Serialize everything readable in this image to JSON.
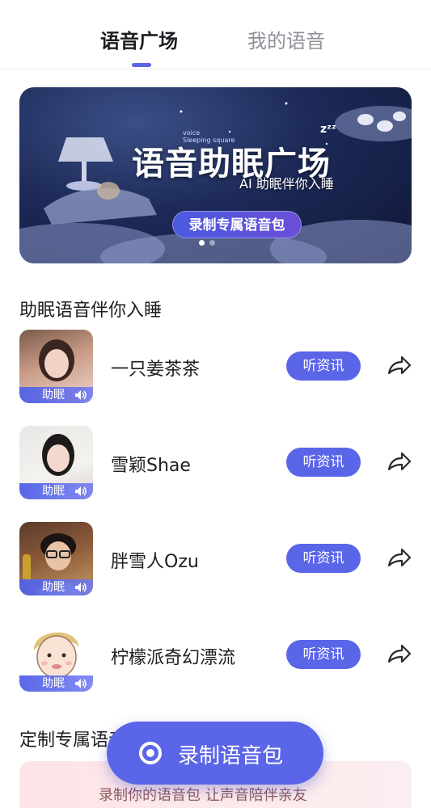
{
  "tabs": [
    {
      "label": "语音广场",
      "active": true
    },
    {
      "label": "我的语音",
      "active": false
    }
  ],
  "banner": {
    "small_text_line1": "voice",
    "small_text_line2": "Sleeping square",
    "title": "语音助眠广场",
    "zz": "zᶻᶻ",
    "subtitle": "AI 助眠伴你入睡",
    "button_label": "录制专属语音包",
    "dots": [
      true,
      false
    ]
  },
  "section_title": "助眠语音伴你入睡",
  "voices": [
    {
      "name": "一只姜茶茶",
      "badge": "助眠",
      "action": "听资讯"
    },
    {
      "name": "雪颖Shae",
      "badge": "助眠",
      "action": "听资讯"
    },
    {
      "name": "胖雪人Ozu",
      "badge": "助眠",
      "action": "听资讯"
    },
    {
      "name": "柠檬派奇幻漂流",
      "badge": "助眠",
      "action": "听资讯"
    }
  ],
  "custom_section_title": "定制专属语音包",
  "promo_text": "录制你的语音包 让声音陪伴亲友",
  "fab_label": "录制语音包",
  "colors": {
    "accent": "#5b65e8",
    "text": "#1d1d22",
    "muted": "#8f8f98"
  }
}
